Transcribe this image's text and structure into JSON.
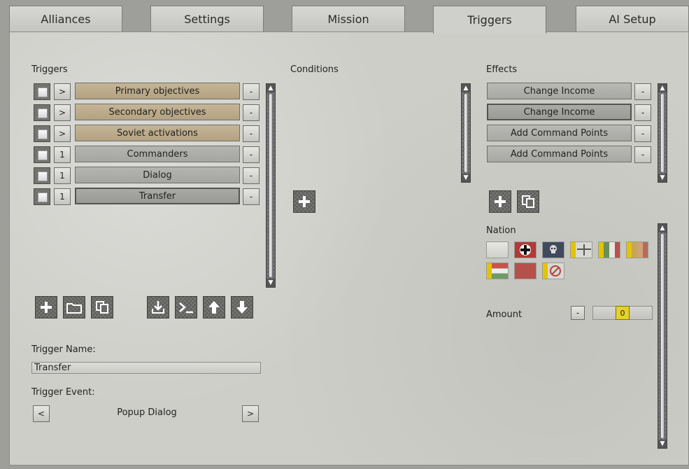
{
  "tabs": [
    "Alliances",
    "Settings",
    "Mission",
    "Triggers",
    "AI Setup"
  ],
  "triggers": {
    "header": "Triggers",
    "rows": [
      {
        "toggle": ">",
        "label": "Primary objectives",
        "remove": "-"
      },
      {
        "toggle": ">",
        "label": "Secondary objectives",
        "remove": "-"
      },
      {
        "toggle": ">",
        "label": "Soviet activations",
        "remove": "-"
      },
      {
        "toggle": "1",
        "label": "Commanders",
        "remove": "-"
      },
      {
        "toggle": "1",
        "label": "Dialog",
        "remove": "-"
      },
      {
        "toggle": "1",
        "label": "Transfer",
        "remove": "-"
      }
    ]
  },
  "conditions": {
    "header": "Conditions"
  },
  "effects": {
    "header": "Effects",
    "rows": [
      {
        "label": "Change Income",
        "remove": "-"
      },
      {
        "label": "Change Income",
        "remove": "-"
      },
      {
        "label": "Add Command Points",
        "remove": "-"
      },
      {
        "label": "Add Command Points",
        "remove": "-"
      }
    ]
  },
  "nation": {
    "label": "Nation",
    "flags": [
      "blank-flag",
      "german-cross-flag",
      "skull-flag",
      "yellow-stripe-flag-1",
      "yellow-stripe-flag-2",
      "yellow-stripe-flag-3",
      "hungary-flag",
      "red-flag",
      "no-entry-flag"
    ]
  },
  "amount": {
    "label": "Amount",
    "minus": "-",
    "value": "0"
  },
  "trigger_name": {
    "label": "Trigger Name:",
    "value": "Transfer"
  },
  "trigger_event": {
    "label": "Trigger Event:",
    "prev": "<",
    "value": "Popup Dialog",
    "next": ">"
  }
}
